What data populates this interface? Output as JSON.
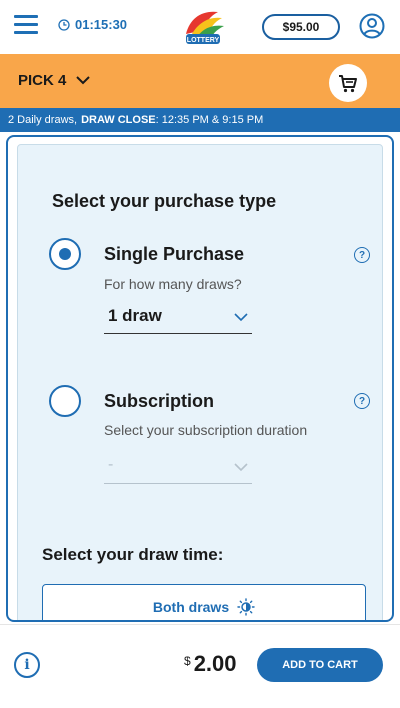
{
  "header": {
    "timer": "01:15:30",
    "balance": "$95.00",
    "logo_text": "LOTTERY",
    "icons": {
      "menu": "hamburger-icon",
      "clock": "clock-icon",
      "profile": "profile-icon"
    }
  },
  "game_bar": {
    "game_name": "PICK 4",
    "icons": {
      "dropdown": "chevron-down-icon",
      "cart": "cart-icon"
    },
    "color": "#f9a64a"
  },
  "info_bar": {
    "draws_text": "2 Daily draws,",
    "close_label": "DRAW CLOSE",
    "close_times": ": 12:35 PM & 9:15 PM",
    "color": "#1f6db3"
  },
  "purchase": {
    "title": "Select your purchase type",
    "single": {
      "label": "Single Purchase",
      "subtitle": "For how many draws?",
      "selected_value": "1 draw",
      "checked": true
    },
    "subscription": {
      "label": "Subscription",
      "subtitle": "Select your subscription duration",
      "selected_value": "-",
      "checked": false
    }
  },
  "draw_time": {
    "title": "Select your draw time:",
    "option_label": "Both draws",
    "option_icon": "sun-moon-icon"
  },
  "footer": {
    "currency": "$",
    "price": "2.00",
    "add_to_cart_label": "ADD TO CART",
    "info_icon_glyph": "i"
  }
}
